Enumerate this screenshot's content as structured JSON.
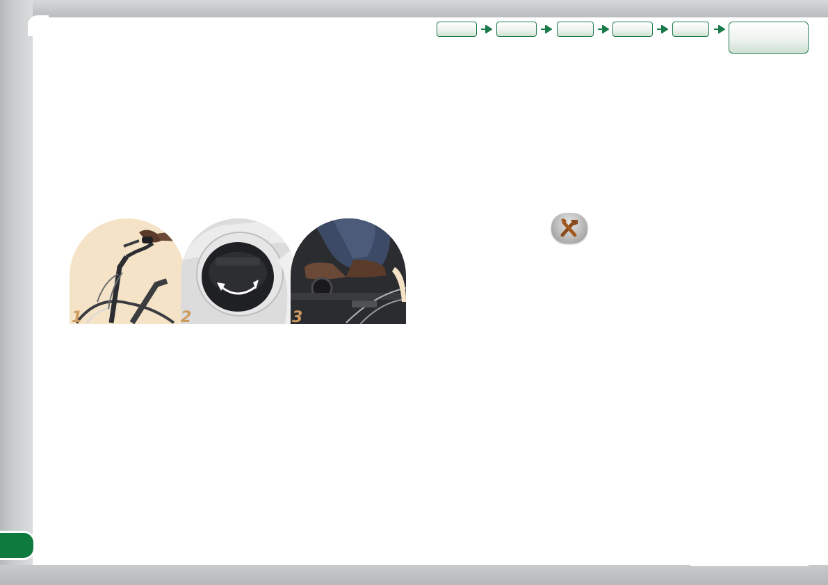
{
  "navigation": {
    "steps": [
      {
        "label": ""
      },
      {
        "label": ""
      },
      {
        "label": ""
      },
      {
        "label": ""
      },
      {
        "label": ""
      },
      {
        "label": ""
      }
    ]
  },
  "illustration": {
    "photos": [
      {
        "number": "1",
        "icon": "handlebar-grip-photo"
      },
      {
        "number": "2",
        "icon": "rotating-cap-photo"
      },
      {
        "number": "3",
        "icon": "pedal-foot-photo"
      }
    ]
  },
  "tool_icon": {
    "icon": "wrench-hammer-icon"
  },
  "colors": {
    "accent_green": "#0f7a3e",
    "frame_grey": "#c6c8ca",
    "photo_beige": "#f4e3c6",
    "number_color": "#cf9a5e"
  }
}
